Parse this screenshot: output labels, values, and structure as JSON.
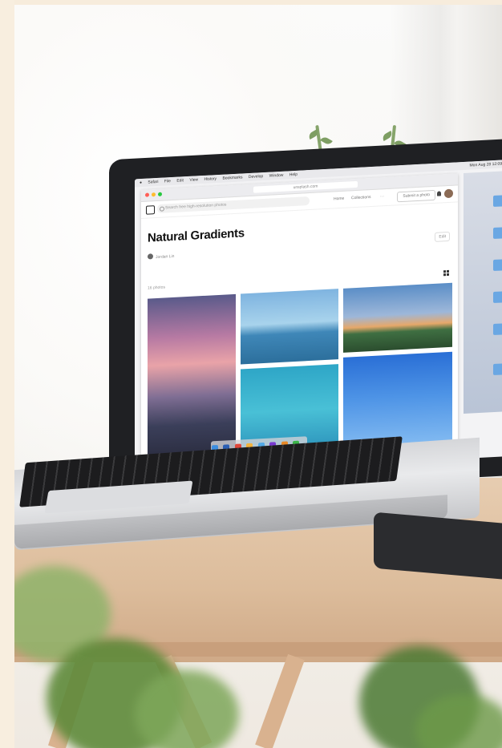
{
  "browser": {
    "url": "unsplash.com",
    "search_placeholder": "Search free high-resolution photos",
    "nav": [
      "Home",
      "Collections",
      "···"
    ],
    "submit_label": "Submit a photo"
  },
  "collection": {
    "title": "Natural Gradients",
    "author": "Jordan Lin",
    "edit_label": "Edit",
    "count": "16 photos"
  },
  "menubar": {
    "items": [
      "Safari",
      "File",
      "Edit",
      "View",
      "History",
      "Bookmarks",
      "Develop",
      "Window",
      "Help"
    ],
    "clock": "Mon Aug 28 12:09 PM"
  },
  "colors": {
    "wood": "#dcbc9b",
    "laptop_frame": "#1f2023",
    "screen_bg": "#f3f3f5"
  }
}
